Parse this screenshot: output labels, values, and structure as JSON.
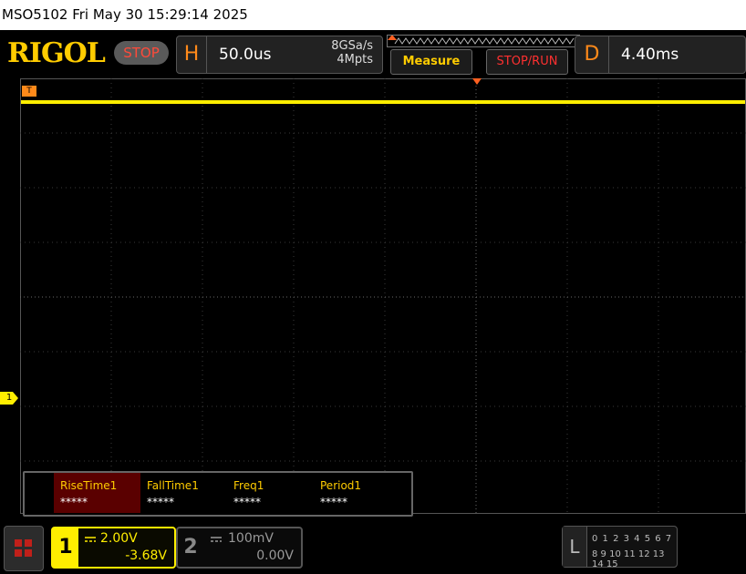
{
  "titlebar": {
    "text": "MSO5102  Fri May 30 15:29:14 2025"
  },
  "header": {
    "logo": "RIGOL",
    "run_state": "STOP",
    "horizontal": {
      "letter": "H",
      "timebase": "50.0us",
      "sample_rate": "8GSa/s",
      "memory_depth": "4Mpts"
    },
    "measure_button": "Measure",
    "stoprun_button": "STOP/RUN",
    "delay": {
      "letter": "D",
      "value": "4.40ms"
    }
  },
  "waveform": {
    "channel1_color": "#ffee00",
    "trigger_color": "#ff8a1a",
    "trigger_level_tag": "T",
    "ch1_ground_marker": "1"
  },
  "measurements": [
    {
      "name": "RiseTime1",
      "value": "*****"
    },
    {
      "name": "FallTime1",
      "value": "*****"
    },
    {
      "name": "Freq1",
      "value": "*****"
    },
    {
      "name": "Period1",
      "value": "*****"
    }
  ],
  "channels": {
    "ch1": {
      "number": "1",
      "scale": "2.00V",
      "offset": "-3.68V"
    },
    "ch2": {
      "number": "2",
      "scale": "100mV",
      "offset": "0.00V"
    }
  },
  "logic_analyzer": {
    "letter": "L",
    "row1": "0 1 2 3  4 5 6 7",
    "row2": "8 9 10 11 12 13 14 15"
  },
  "icons": {
    "menu": "menu-grid-icon",
    "coupling": "dc-coupling-icon"
  }
}
